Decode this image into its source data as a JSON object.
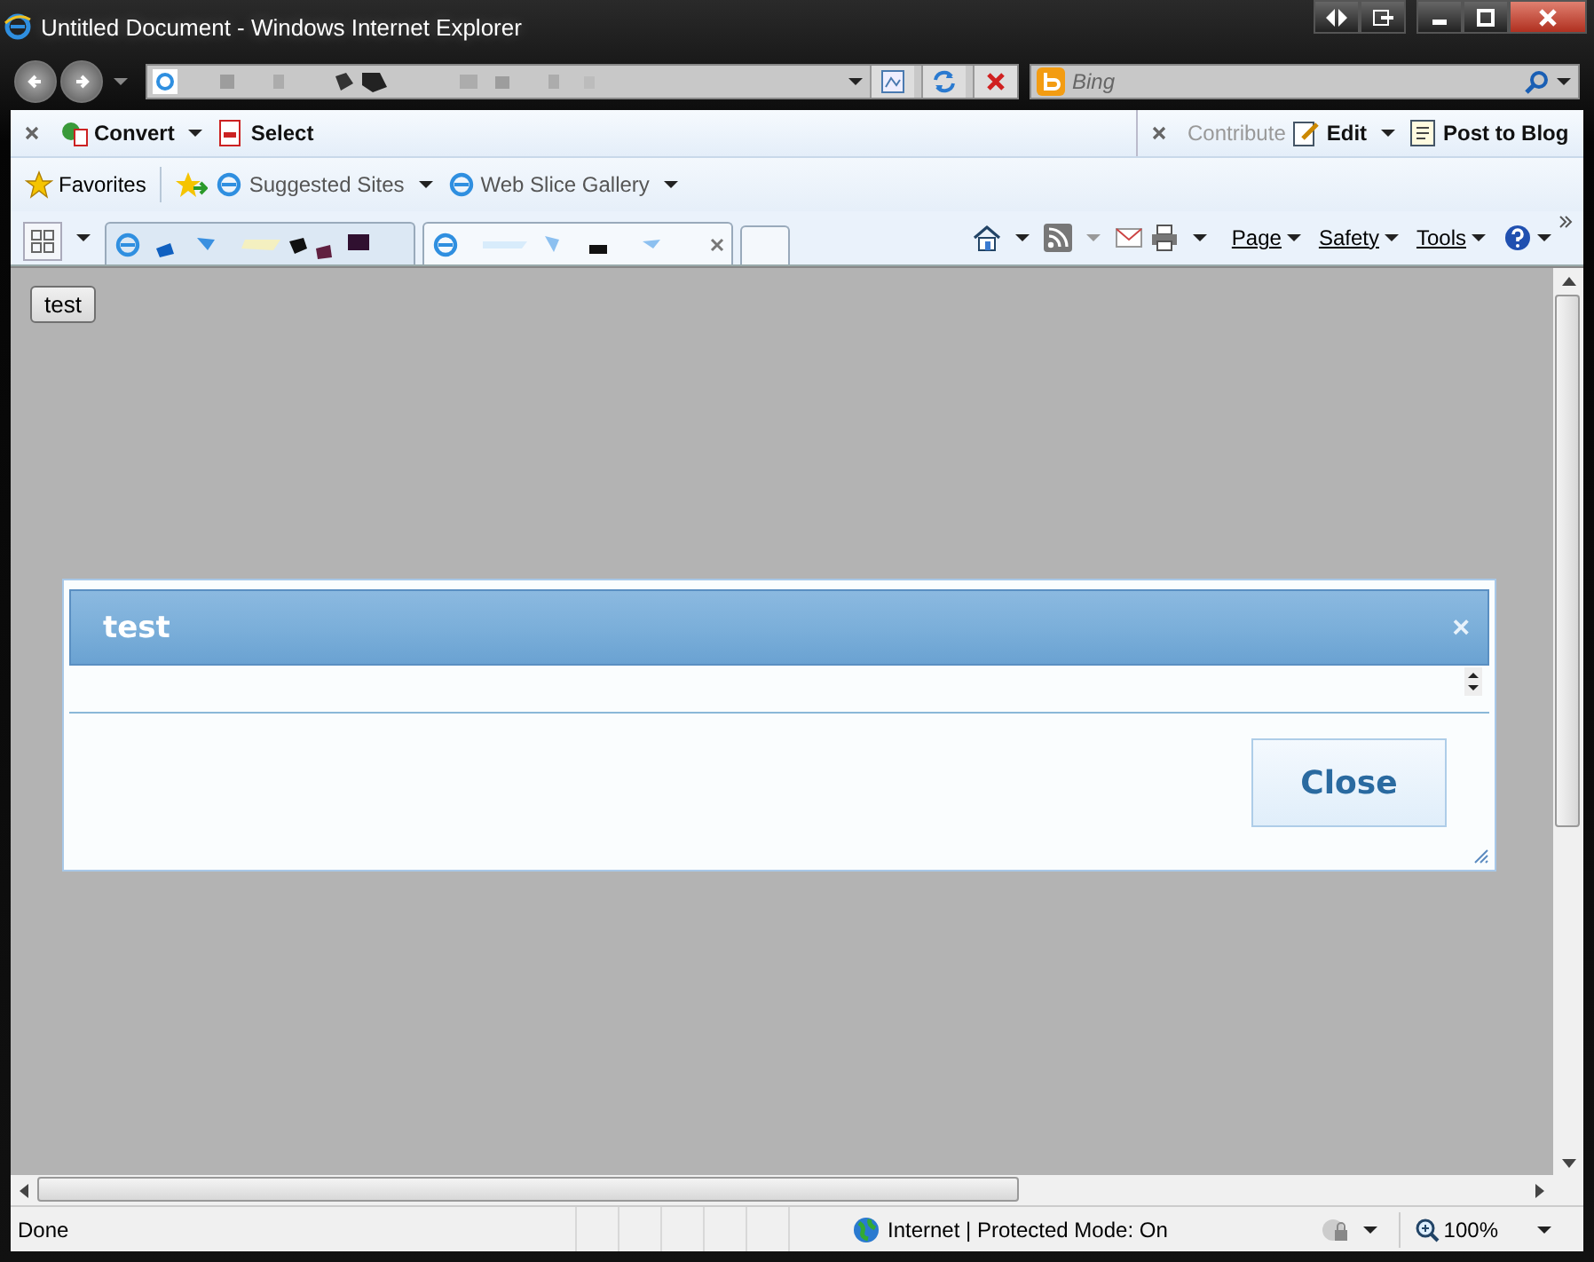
{
  "window": {
    "title": "Untitled Document - Windows Internet Explorer"
  },
  "search": {
    "placeholder": "Bing"
  },
  "command_bar": {
    "left": [
      {
        "label": "Convert",
        "has_menu": true
      },
      {
        "label": "Select",
        "has_menu": false
      }
    ],
    "right": [
      {
        "label": "Contribute",
        "disabled": true,
        "has_menu": false
      },
      {
        "label": "Edit",
        "disabled": false,
        "has_menu": true
      },
      {
        "label": "Post to Blog",
        "disabled": false,
        "has_menu": false
      }
    ]
  },
  "favorites_bar": {
    "favorites": "Favorites",
    "links": [
      {
        "label": "Suggested Sites",
        "has_menu": true
      },
      {
        "label": "Web Slice Gallery",
        "has_menu": true
      }
    ]
  },
  "tabs": [
    {
      "selected": false
    },
    {
      "selected": true
    }
  ],
  "command_menus": [
    {
      "label": "Page"
    },
    {
      "label": "Safety"
    },
    {
      "label": "Tools"
    }
  ],
  "page": {
    "button": "test"
  },
  "dialog": {
    "title": "test",
    "close_glyph": "×",
    "button": "Close"
  },
  "status_bar": {
    "status": "Done",
    "zone": "Internet | Protected Mode: On",
    "zoom": "100%"
  }
}
